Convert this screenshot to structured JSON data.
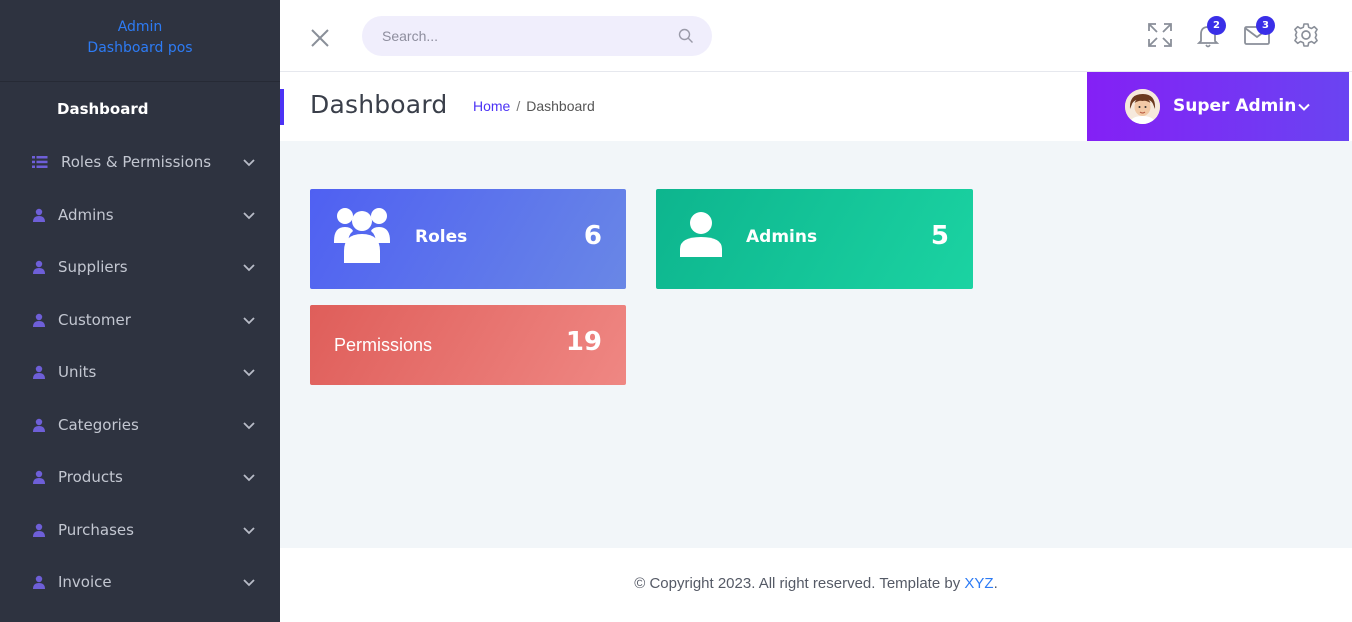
{
  "brand": {
    "line1": "Admin",
    "line2": "Dashboard pos"
  },
  "sidebar": {
    "active": "Dashboard",
    "items": [
      {
        "label": "Roles & Permissions",
        "icon": "list-icon"
      },
      {
        "label": "Admins",
        "icon": "user-icon"
      },
      {
        "label": "Suppliers",
        "icon": "user-icon"
      },
      {
        "label": "Customer",
        "icon": "user-icon"
      },
      {
        "label": "Units",
        "icon": "user-icon"
      },
      {
        "label": "Categories",
        "icon": "user-icon"
      },
      {
        "label": "Products",
        "icon": "user-icon"
      },
      {
        "label": "Purchases",
        "icon": "user-icon"
      },
      {
        "label": "Invoice",
        "icon": "user-icon"
      }
    ]
  },
  "topbar": {
    "search_placeholder": "Search...",
    "notifications_count": "2",
    "messages_count": "3"
  },
  "header": {
    "title": "Dashboard",
    "breadcrumb_home": "Home",
    "breadcrumb_sep": "/",
    "breadcrumb_current": "Dashboard"
  },
  "profile": {
    "name": "Super Admin"
  },
  "cards": {
    "roles": {
      "label": "Roles",
      "value": "6"
    },
    "admins": {
      "label": "Admins",
      "value": "5"
    },
    "permissions": {
      "label": "Permissions",
      "value": "19"
    }
  },
  "footer": {
    "text": "© Copyright 2023. All right reserved. Template by ",
    "link": "XYZ",
    "end": "."
  },
  "colors": {
    "sidebar_bg": "#2e3340",
    "accent": "#4c33f5",
    "profile_gradient": [
      "#8420f5",
      "#6a44f2"
    ],
    "roles_card": "#4f60f2",
    "admins_card": "#0db58e",
    "permissions_card": "#df5e5a"
  }
}
